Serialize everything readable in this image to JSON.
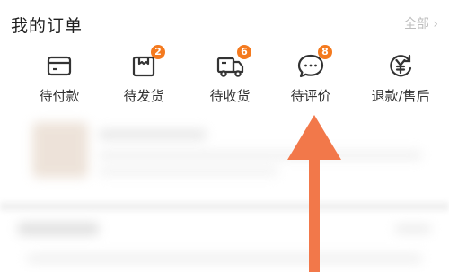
{
  "header": {
    "title": "我的订单",
    "all_link": "全部 ›"
  },
  "orders": [
    {
      "label": "待付款",
      "icon": "wallet-icon",
      "badge": ""
    },
    {
      "label": "待发货",
      "icon": "package-icon",
      "badge": "2"
    },
    {
      "label": "待收货",
      "icon": "truck-icon",
      "badge": "6"
    },
    {
      "label": "待评价",
      "icon": "chat-bubble-icon",
      "badge": "8"
    },
    {
      "label": "退款/售后",
      "icon": "refund-yen-icon",
      "badge": ""
    }
  ],
  "colors": {
    "accent": "#f47a1f",
    "arrow": "#f2784a",
    "text": "#333333",
    "muted": "#bdbdbd"
  }
}
